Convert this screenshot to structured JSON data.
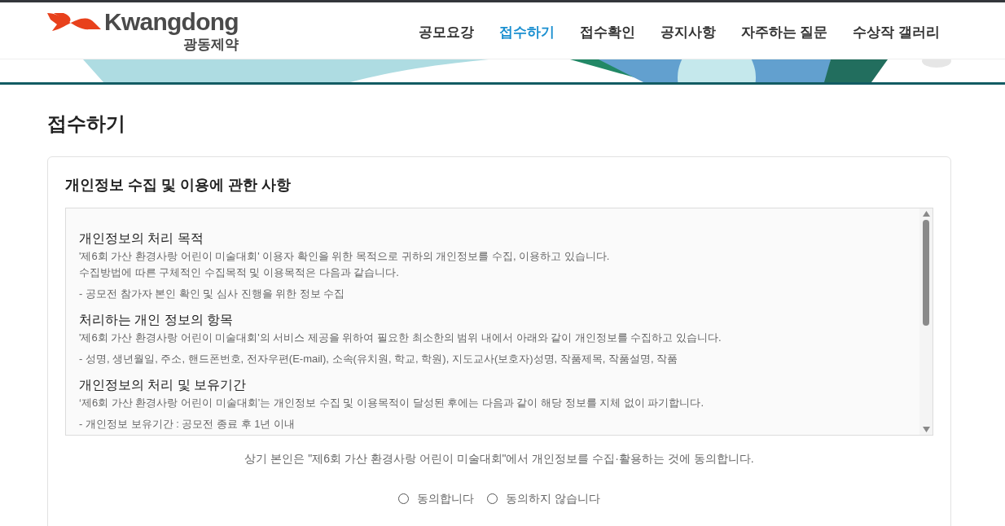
{
  "header": {
    "logo": {
      "wordmark": "Kwangdong",
      "subtitle": "광동제약"
    },
    "nav": [
      {
        "label": "공모요강",
        "selected": false
      },
      {
        "label": "접수하기",
        "selected": true
      },
      {
        "label": "접수확인",
        "selected": false
      },
      {
        "label": "공지사항",
        "selected": false
      },
      {
        "label": "자주하는 질문",
        "selected": false
      },
      {
        "label": "수상작 갤러리",
        "selected": false
      }
    ]
  },
  "page_title": "접수하기",
  "privacy": {
    "title": "개인정보 수집 및 이용에 관한 사항",
    "sections": [
      {
        "heading": "개인정보의 처리 목적",
        "lines": [
          "'제6회 가산 환경사랑 어린이 미술대회' 이용자 확인을 위한 목적으로 귀하의 개인정보를 수집, 이용하고 있습니다.",
          "수집방법에 따른 구체적인 수집목적 및 이용목적은 다음과 같습니다."
        ],
        "items": [
          "- 공모전 참가자 본인 확인 및 심사 진행을 위한 정보 수집"
        ]
      },
      {
        "heading": "처리하는 개인 정보의 항목",
        "lines": [
          "'제6회 가산 환경사랑 어린이 미술대회'의 서비스 제공을 위하여 필요한 최소한의 범위 내에서 아래와 같이 개인정보를 수집하고 있습니다."
        ],
        "items": [
          "- 성명, 생년월일, 주소, 핸드폰번호, 전자우편(E-mail), 소속(유치원, 학교, 학원), 지도교사(보호자)성명, 작품제목, 작품설명, 작품"
        ]
      },
      {
        "heading": "개인정보의 처리 및 보유기간",
        "lines": [
          "‘제6회 가산 환경사랑 어린이 미술대회’는 개인정보 수집 및 이용목적이 달성된 후에는 다음과 같이 해당 정보를 지체 없이 파기합니다."
        ],
        "items": [
          "- 개인정보 보유기간 : 공모전 종료 후 1년 이내"
        ]
      }
    ],
    "consent_text": "상기 본인은 \"제6회 가산 환경사랑 어린이 미술대회\"에서 개인정보를 수집·활용하는 것에 동의합니다.",
    "options": [
      {
        "label": "동의합니다",
        "selected": false
      },
      {
        "label": "동의하지 않습니다",
        "selected": false
      }
    ]
  }
}
